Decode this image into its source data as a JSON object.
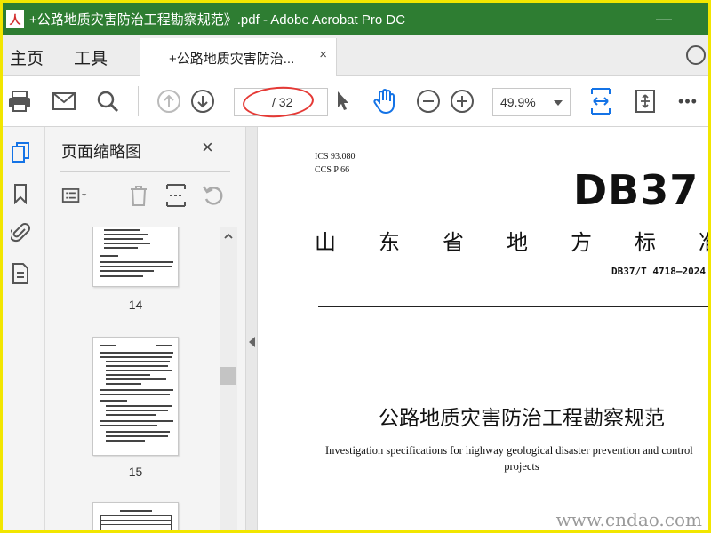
{
  "window": {
    "app_icon_letter": "人",
    "title": "+公路地质灾害防治工程勘察规范》.pdf - Adobe Acrobat Pro DC",
    "minimize_glyph": "—"
  },
  "menu": {
    "home": "主页",
    "tools": "工具"
  },
  "tab": {
    "label": "+公路地质灾害防治...",
    "close": "×"
  },
  "toolbar": {
    "page_current": "",
    "page_total": "/ 32",
    "zoom": "49.9%",
    "more": "•••"
  },
  "panel": {
    "title": "页面缩略图",
    "close": "×",
    "thumbnails": [
      {
        "page_label": "14"
      },
      {
        "page_label": "15"
      },
      {
        "page_label": ""
      }
    ]
  },
  "document": {
    "ics": "ICS  93.080",
    "ccs": "CCS  P 66",
    "standard_code": "DB37",
    "province_title_chars": [
      "山",
      "东",
      "省",
      "地",
      "方",
      "标",
      "准"
    ],
    "standard_number": "DB37/T 4718—2024",
    "title_cn": "公路地质灾害防治工程勘察规范",
    "title_en_line1": "Investigation specifications for highway geological disaster prevention and control",
    "title_en_line2": "projects"
  },
  "watermark": "www.cndao.com",
  "colors": {
    "titlebar": "#2e7d32",
    "accent_blue": "#1473e6",
    "annotation_red": "#e53935",
    "frame_yellow": "#f2e600"
  }
}
